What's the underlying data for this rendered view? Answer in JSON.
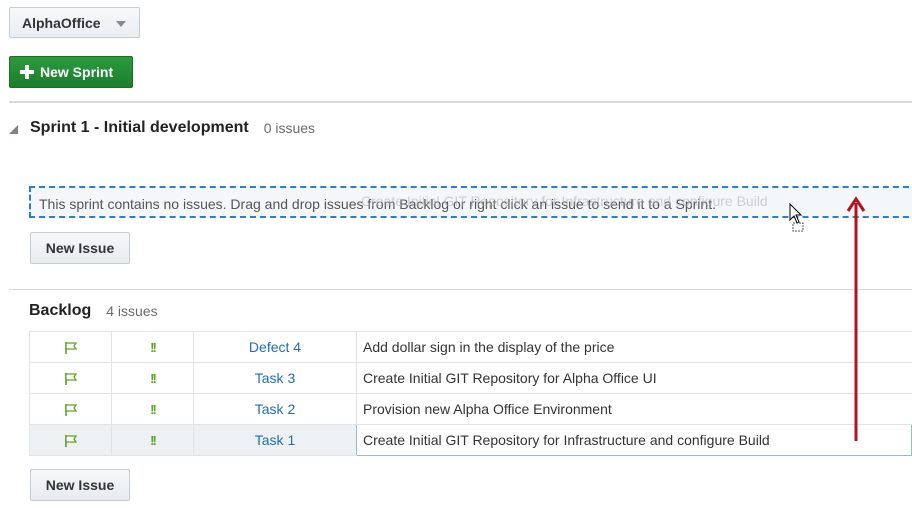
{
  "project": {
    "name": "AlphaOffice"
  },
  "toolbar": {
    "new_sprint_label": "New Sprint"
  },
  "sprint": {
    "title": "Sprint 1 - Initial development",
    "count": "0 issues",
    "empty_message": "This sprint contains no issues. Drag and drop issues from Backlog or right click an issue to send it to a Sprint.",
    "drag_ghost_text": "Create Initial GIT Repository for Infrastructure and configure Build",
    "new_issue_label": "New Issue"
  },
  "backlog": {
    "title": "Backlog",
    "count": "4 issues",
    "new_issue_label": "New Issue",
    "rows": [
      {
        "key": "Defect 4",
        "summary": "Add dollar sign in the display of the price",
        "priority": "!!"
      },
      {
        "key": "Task 3",
        "summary": "Create Initial GIT Repository for Alpha Office UI",
        "priority": "!!"
      },
      {
        "key": "Task 2",
        "summary": "Provision new Alpha Office Environment",
        "priority": "!!"
      },
      {
        "key": "Task 1",
        "summary": "Create Initial GIT Repository for Infrastructure and configure Build",
        "priority": "!!",
        "selected": true
      }
    ]
  },
  "colors": {
    "accent_green": "#1d7d2d",
    "link_blue": "#1f6fb2",
    "arrow_red": "#b3121e",
    "dash_blue": "#2a7fcf"
  }
}
